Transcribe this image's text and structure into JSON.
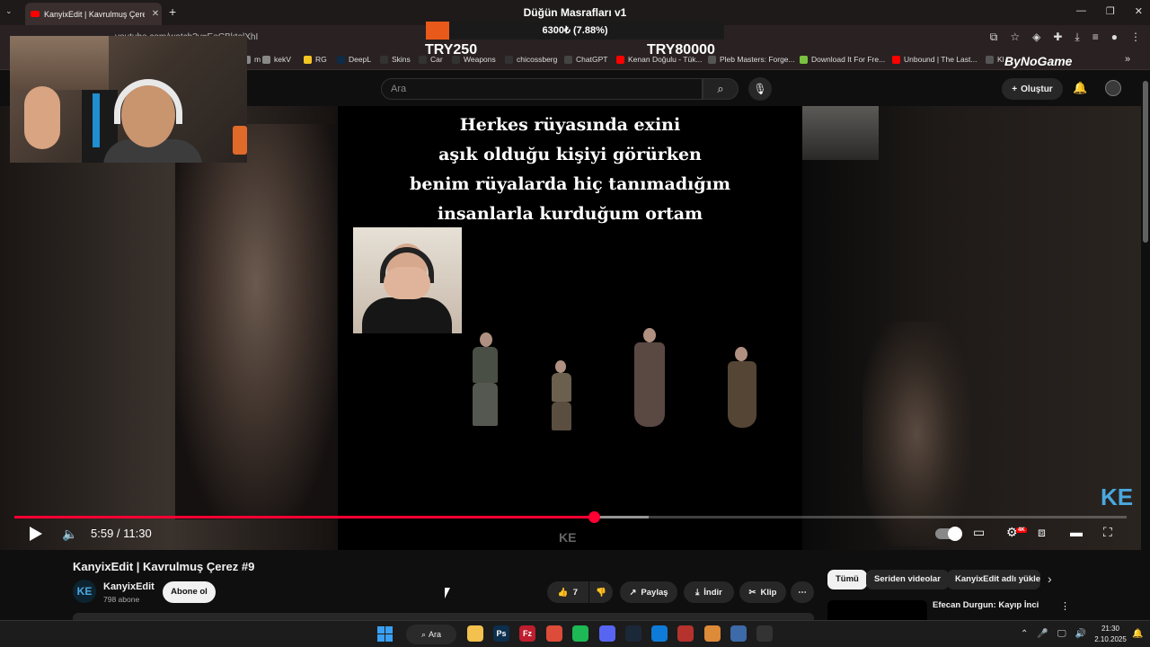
{
  "browser": {
    "tab_title": "KanyixEdit | Kavrulmuş Çerez #9",
    "url": "youtube.com/watch?v=EeCBktolXhI",
    "bookmarks": [
      {
        "label": "m",
        "color": "#888888"
      },
      {
        "label": "kekV",
        "color": "#888888"
      },
      {
        "label": "RG",
        "color": "#f3c623"
      },
      {
        "label": "DeepL",
        "color": "#0f2b46"
      },
      {
        "label": "Skins",
        "color": "#333333"
      },
      {
        "label": "Car",
        "color": "#333333"
      },
      {
        "label": "Weapons",
        "color": "#333333"
      },
      {
        "label": "chicossberg",
        "color": "#333333"
      },
      {
        "label": "ChatGPT",
        "color": "#444444"
      },
      {
        "label": "Kenan Doğulu - Tük...",
        "color": "#ff0000"
      },
      {
        "label": "Pleb Masters: Forge...",
        "color": "#555555"
      },
      {
        "label": "Download It For Fre...",
        "color": "#7ac142"
      },
      {
        "label": "Unbound | The Last...",
        "color": "#ff0000"
      },
      {
        "label": "Kl",
        "color": "#555555"
      }
    ]
  },
  "overlay": {
    "title": "Düğün Masrafları v1",
    "progress_text": "6300₺ (7.88%)",
    "progress_fraction": 0.0788,
    "min_label": "TRY250",
    "max_label": "TRY80000",
    "sponsor": "ByNoGame",
    "fill_color": "#e8591a"
  },
  "youtube": {
    "search_placeholder": "Ara",
    "create_label": "Oluştur",
    "video_caption": [
      "Herkes rüyasında exini",
      "aşık olduğu kişiyi görürken",
      "benim rüyalarda hiç tanımadığım",
      "insanlarla kurduğum ortam"
    ],
    "player": {
      "time": "5:59 / 11:30",
      "played_fraction": 0.521,
      "buffered_fraction": 0.57,
      "quality_badge": "4K",
      "accent": "#ff0033"
    },
    "video": {
      "title": "KanyixEdit | Kavrulmuş Çerez #9",
      "channel": "KanyixEdit",
      "subscribers": "798 abone",
      "subscribe_label": "Abone ol",
      "likes": "7",
      "share_label": "Paylaş",
      "download_label": "İndir",
      "clip_label": "Klip"
    },
    "chips": [
      "Tümü",
      "Seriden videolar",
      "KanyixEdit adlı yükle"
    ],
    "recommended": {
      "title": "Efecan Durgun: Kayıp İnci"
    }
  },
  "taskbar": {
    "search_label": "Ara",
    "time": "21:30",
    "date": "2.10.2025",
    "apps": [
      {
        "icon": "file-explorer-icon",
        "color": "#f2c14e",
        "label": ""
      },
      {
        "icon": "photoshop-icon",
        "color": "#0c2f4e",
        "label": "Ps"
      },
      {
        "icon": "filezilla-icon",
        "color": "#bf1e2e",
        "label": "Fz"
      },
      {
        "icon": "chrome-icon",
        "color": "#dd4b39",
        "label": ""
      },
      {
        "icon": "spotify-icon",
        "color": "#1db954",
        "label": ""
      },
      {
        "icon": "discord-icon",
        "color": "#5865f2",
        "label": ""
      },
      {
        "icon": "steam-icon",
        "color": "#1b2838",
        "label": ""
      },
      {
        "icon": "edge-icon",
        "color": "#0f7bd8",
        "label": ""
      },
      {
        "icon": "tool-icon",
        "color": "#b5322d",
        "label": ""
      },
      {
        "icon": "chrome-active-icon",
        "color": "#dd8a39",
        "label": ""
      },
      {
        "icon": "app-icon",
        "color": "#3d6aa8",
        "label": ""
      },
      {
        "icon": "obs-icon",
        "color": "#333333",
        "label": ""
      }
    ]
  }
}
